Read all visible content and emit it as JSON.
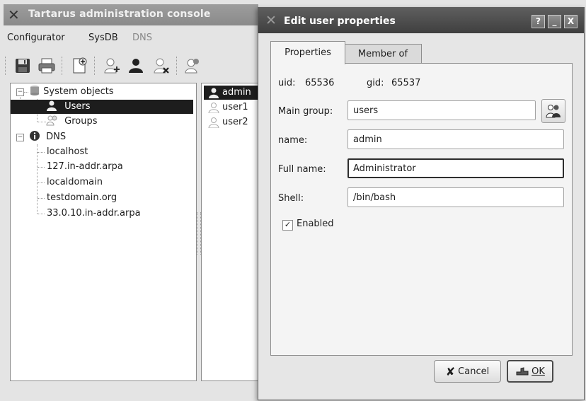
{
  "main_window": {
    "title": "Tartarus administration console",
    "menu": [
      "Configurator",
      "SysDB",
      "DNS"
    ],
    "toolbar_icons": [
      "save-icon",
      "print-icon",
      "new-document-icon",
      "add-user-icon",
      "user-icon",
      "delete-user-icon",
      "user-properties-icon"
    ],
    "tree": {
      "system_objects": "System objects",
      "users": "Users",
      "groups": "Groups",
      "dns": "DNS",
      "dns_zones": [
        "localhost",
        "127.in-addr.arpa",
        "localdomain",
        "testdomain.org",
        "33.0.10.in-addr.arpa"
      ]
    },
    "user_list": [
      "admin",
      "user1",
      "user2"
    ]
  },
  "dialog": {
    "title": "Edit user properties",
    "title_buttons": {
      "help": "?",
      "minimize": "_",
      "close": "X"
    },
    "tabs": [
      "Properties",
      "Member of"
    ],
    "uid_label": "uid:",
    "uid_value": "65536",
    "gid_label": "gid:",
    "gid_value": "65537",
    "main_group_label": "Main group:",
    "main_group_value": "users",
    "name_label": "name:",
    "name_value": "admin",
    "full_name_label": "Full name:",
    "full_name_value": "Administrator",
    "shell_label": "Shell:",
    "shell_value": "/bin/bash",
    "enabled_label": "Enabled",
    "enabled_checked": true,
    "cancel_label": "Cancel",
    "ok_label": "OK"
  }
}
